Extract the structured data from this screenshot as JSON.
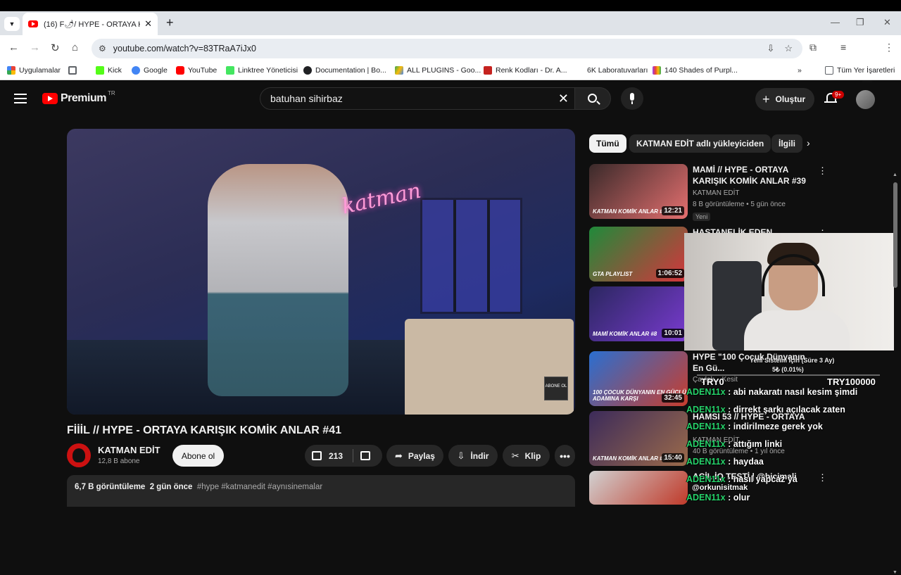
{
  "browser": {
    "tab_title": "(16) F🌶/ HYPE - ORTAYA KAR",
    "url": "youtube.com/watch?v=83TRaA7iJx0",
    "bookmarks": [
      {
        "label": "Uygulamalar",
        "color": "#e94235"
      },
      {
        "label": "",
        "color": "#5f6368"
      },
      {
        "label": "Kick",
        "color": "#53fc18"
      },
      {
        "label": "Google",
        "color": "#4285f4"
      },
      {
        "label": "YouTube",
        "color": "#ff0000"
      },
      {
        "label": "Linktree Yöneticisi",
        "color": "#43e660"
      },
      {
        "label": "Documentation | Bo...",
        "color": "#202124"
      },
      {
        "label": "ALL PLUGINS - Goo...",
        "color": "#34a853"
      },
      {
        "label": "Renk Kodları - Dr. A...",
        "color": "#c5221f"
      },
      {
        "label": "6K Laboratuvarları",
        "color": ""
      },
      {
        "label": "140 Shades of Purpl...",
        "color": "#a142f4"
      }
    ],
    "all_bookmarks": "Tüm Yer İşaretleri"
  },
  "youtube": {
    "logo_text": "Premium",
    "region": "TR",
    "search_query": "batuhan sihirbaz",
    "create_label": "Oluştur",
    "notif_count": "9+",
    "accent": "#ff0000"
  },
  "video": {
    "overlay_text": "katman",
    "abone_label": "ABONE OL",
    "title": "FİİİL // HYPE - ORTAYA KARIŞIK KOMİK ANLAR #41",
    "channel": "KATMAN EDİT",
    "subscribers": "12,8 B abone",
    "subscribe_label": "Abone ol",
    "likes": "213",
    "share_label": "Paylaş",
    "download_label": "İndir",
    "clip_label": "Klip",
    "views": "6,7 B görüntüleme",
    "date": "2 gün önce",
    "tags": "#hype #katmanedit #aynısinemalar"
  },
  "chips": [
    "Tümü",
    "KATMAN EDİT adlı yükleyiciden",
    "İlgili"
  ],
  "recommendations": [
    {
      "title": "MAMİ // HYPE - ORTAYA KARIŞIK KOMİK ANLAR #39",
      "channel": "KATMAN EDİT",
      "meta": "8 B görüntüleme • 5 gün önce",
      "badge": "Yeni",
      "duration": "12:21",
      "label": "KATMAN KOMİK ANLAR #39",
      "c1": "#3a2a2a",
      "c2": "#e46f6f"
    },
    {
      "title": "HASTANELİK EDEN İMKANSIZ",
      "channel": "",
      "meta": "",
      "badge": "",
      "duration": "1:06:52",
      "label": "GTA PLAYLIST",
      "c1": "#1f8a3a",
      "c2": "#d8343c"
    },
    {
      "title": "",
      "channel": "",
      "meta": "",
      "badge": "",
      "duration": "10:01",
      "label": "MAMİ KOMİK ANLAR #8",
      "c1": "#2b2760",
      "c2": "#7a3bd1"
    },
    {
      "title": "HYPE \"100 Çocuk Dünyanın En Gü...",
      "channel": "Çaylak... Kesit",
      "meta": "",
      "badge": "",
      "duration": "32:45",
      "label": "100 ÇOCUK DÜNYANIN EN GÜÇLÜ ADAMINA KARŞI",
      "c1": "#2a6fd1",
      "c2": "#c93d2d"
    },
    {
      "title": "HAMSİ 53 // HYPE - ORTAYA",
      "channel": "KATMAN EDİT",
      "meta": "40 B görüntüleme • 1 yıl önce",
      "badge": "",
      "duration": "15:40",
      "label": "KATMAN KOMİK ANLAR #24",
      "c1": "#3c2b5a",
      "c2": "#9b6a4a"
    },
    {
      "title": "ACİL İQ TESTİ | @bicimali",
      "channel": "",
      "meta": "",
      "badge": "",
      "duration": "",
      "label": "",
      "c1": "#d1d1d1",
      "c2": "#c03a2a"
    }
  ],
  "stream_overlay": {
    "donate_goal": "Yeni Sisteim İçin (Süre 3 Ay)",
    "donate_progress": "5₺ (0.01%)",
    "donate_min": "TRY0",
    "donate_max": "TRY100000",
    "chat": [
      {
        "user": "ADEN11x",
        "text": " : abi nakaratı nasıl kesim şimdi"
      },
      {
        "user": "ADEN11x",
        "text": " : dirrekt şarkı açılacak zaten"
      },
      {
        "user": "ADEN11x",
        "text": " : indirilmeze gerek yok"
      },
      {
        "user": "ADEN11x",
        "text": " : attığım linki"
      },
      {
        "user": "ADEN11x",
        "text": " : haydaa"
      },
      {
        "user": "ADEN11x",
        "text": " : nasıl yapcaz ya"
      },
      {
        "user": "",
        "text": "@orkunisitmak"
      },
      {
        "user": "ADEN11x",
        "text": " : olur"
      }
    ],
    "user_color": "#27d36b"
  }
}
